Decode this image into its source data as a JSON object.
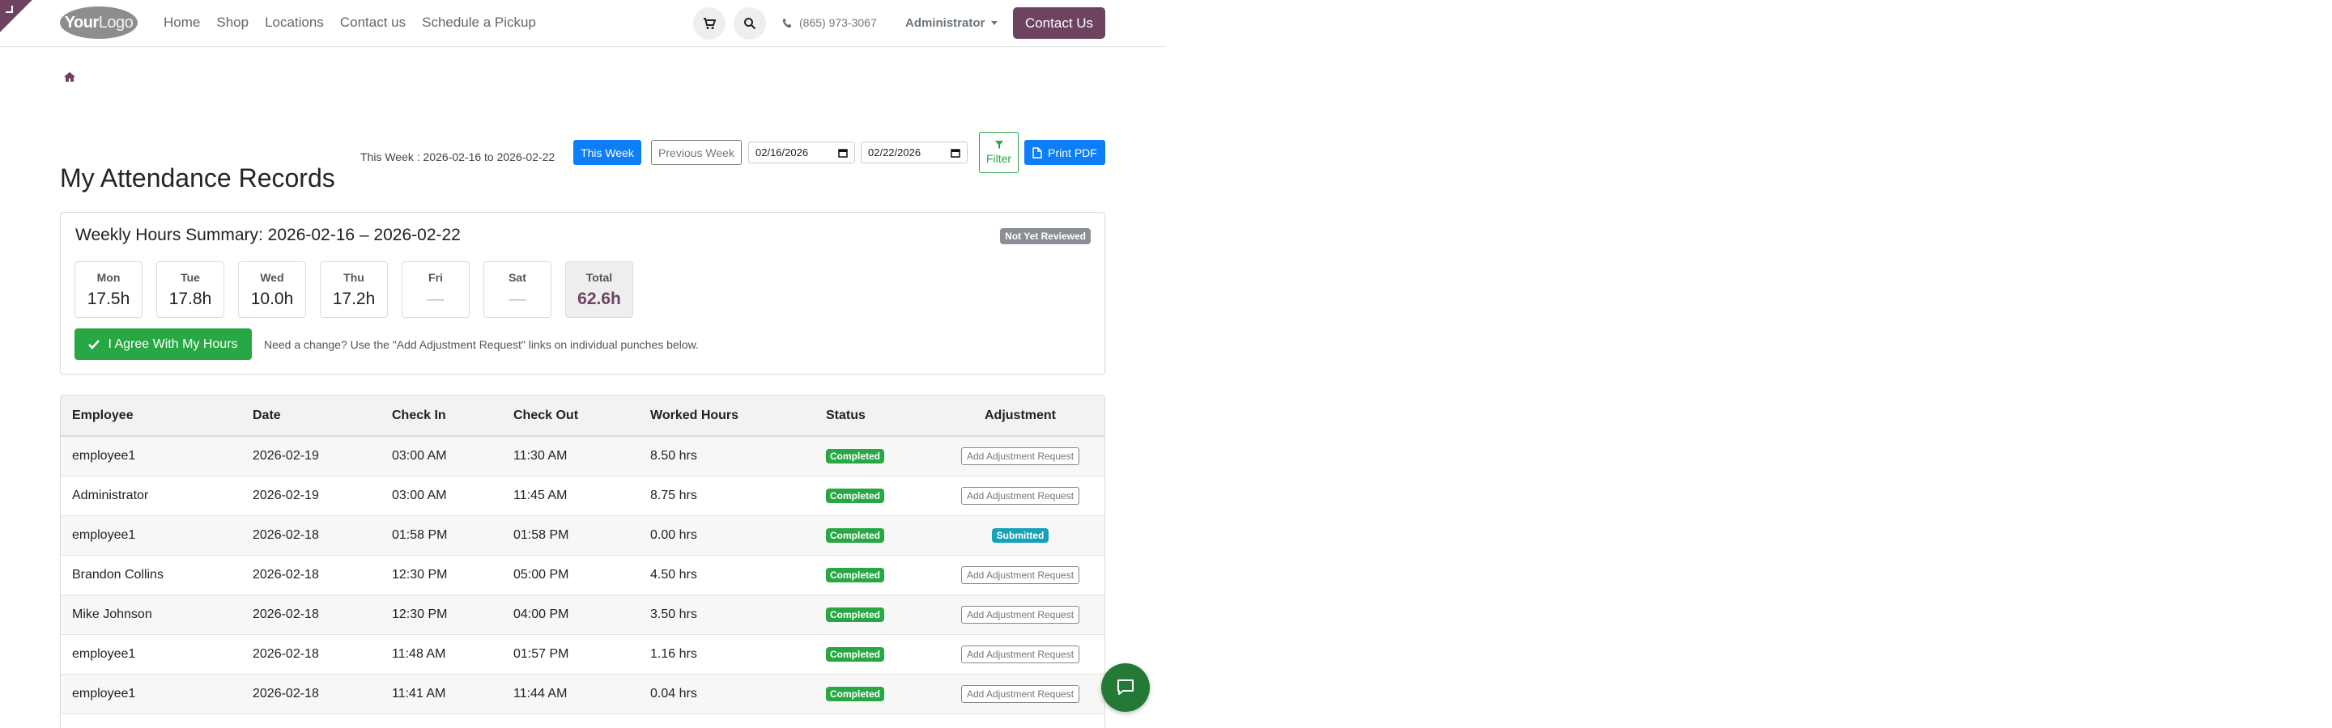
{
  "header": {
    "logo_bold": "Your",
    "logo_light": "Logo",
    "nav": [
      "Home",
      "Shop",
      "Locations",
      "Contact us",
      "Schedule a Pickup"
    ],
    "phone": "(865) 973-3067",
    "user": "Administrator",
    "contact_button": "Contact Us"
  },
  "page": {
    "title": "My Attendance Records",
    "week_range": "This Week : 2026-02-16 to 2026-02-22",
    "this_week_button": "This Week",
    "previous_week_button": "Previous Week",
    "date_from": "02/16/2026",
    "date_to": "02/22/2026",
    "filter_button": "Filter",
    "print_button": "Print PDF"
  },
  "summary": {
    "title": "Weekly Hours Summary: 2026-02-16 – 2026-02-22",
    "review_badge": "Not Yet Reviewed",
    "days": [
      {
        "name": "Mon",
        "hours": "17.5h"
      },
      {
        "name": "Tue",
        "hours": "17.8h"
      },
      {
        "name": "Wed",
        "hours": "10.0h"
      },
      {
        "name": "Thu",
        "hours": "17.2h"
      },
      {
        "name": "Fri",
        "hours": "—"
      },
      {
        "name": "Sat",
        "hours": "—"
      },
      {
        "name": "Total",
        "hours": "62.6h"
      }
    ],
    "agree_button": "I Agree With My Hours",
    "note": "Need a change? Use the \"Add Adjustment Request\" links on individual punches below."
  },
  "table": {
    "headers": [
      "Employee",
      "Date",
      "Check In",
      "Check Out",
      "Worked Hours",
      "Status",
      "Adjustment"
    ],
    "rows": [
      {
        "employee": "employee1",
        "date": "2026-02-19",
        "in": "03:00 AM",
        "out": "11:30 AM",
        "hours": "8.50 hrs",
        "status": "Completed",
        "adjustment": "Add Adjustment Request"
      },
      {
        "employee": "Administrator",
        "date": "2026-02-19",
        "in": "03:00 AM",
        "out": "11:45 AM",
        "hours": "8.75 hrs",
        "status": "Completed",
        "adjustment": "Add Adjustment Request"
      },
      {
        "employee": "employee1",
        "date": "2026-02-18",
        "in": "01:58 PM",
        "out": "01:58 PM",
        "hours": "0.00 hrs",
        "status": "Completed",
        "adjustment": "Submitted"
      },
      {
        "employee": "Brandon Collins",
        "date": "2026-02-18",
        "in": "12:30 PM",
        "out": "05:00 PM",
        "hours": "4.50 hrs",
        "status": "Completed",
        "adjustment": "Add Adjustment Request"
      },
      {
        "employee": "Mike Johnson",
        "date": "2026-02-18",
        "in": "12:30 PM",
        "out": "04:00 PM",
        "hours": "3.50 hrs",
        "status": "Completed",
        "adjustment": "Add Adjustment Request"
      },
      {
        "employee": "employee1",
        "date": "2026-02-18",
        "in": "11:48 AM",
        "out": "01:57 PM",
        "hours": "1.16 hrs",
        "status": "Completed",
        "adjustment": "Add Adjustment Request"
      },
      {
        "employee": "employee1",
        "date": "2026-02-18",
        "in": "11:41 AM",
        "out": "11:44 AM",
        "hours": "0.04 hrs",
        "status": "Completed",
        "adjustment": "Add Adjustment Request"
      }
    ]
  },
  "colors": {
    "brand": "#6e4360",
    "primary": "#0d7ef7",
    "success": "#28a745",
    "info": "#17a2b8"
  }
}
